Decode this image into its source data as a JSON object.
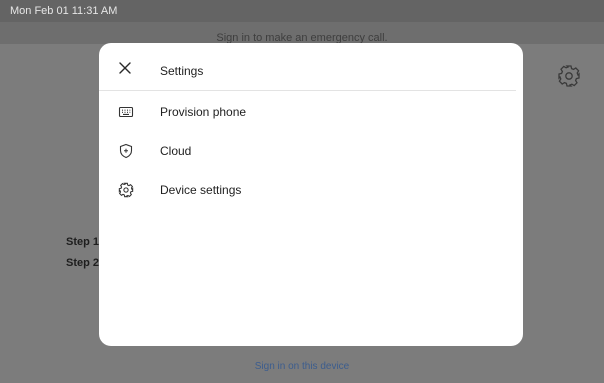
{
  "status_bar": {
    "datetime": "Mon Feb 01  11:31 AM"
  },
  "banner": {
    "text": "Sign in to make an emergency call."
  },
  "background": {
    "steps": [
      "Step 1",
      "Step 2"
    ],
    "sign_in_link": "Sign in on this device",
    "gear_icon": "gear-icon"
  },
  "dialog": {
    "title": "Settings",
    "close_icon": "close-icon",
    "items": [
      {
        "label": "Provision phone",
        "icon": "keyboard-icon"
      },
      {
        "label": "Cloud",
        "icon": "shield-icon"
      },
      {
        "label": "Device settings",
        "icon": "gear-icon"
      }
    ]
  },
  "colors": {
    "overlay": "#7c7c7c",
    "status_bar": "#646464",
    "dialog_bg": "#ffffff",
    "link": "#3c5d8e"
  }
}
